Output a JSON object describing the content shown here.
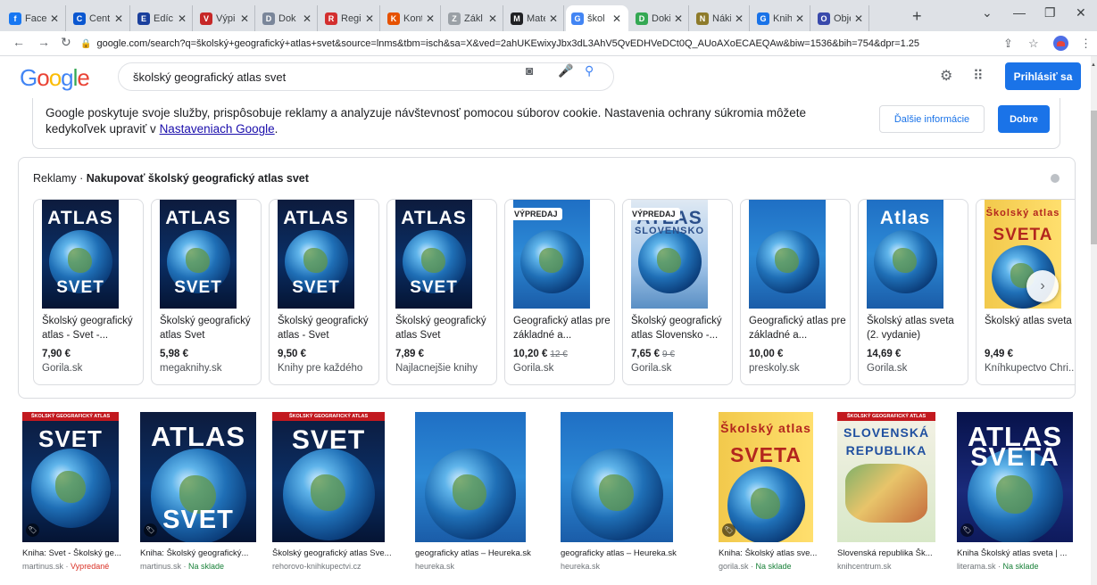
{
  "browser": {
    "tabs": [
      {
        "label": "Face",
        "color": "#1877f2",
        "glyph": "f"
      },
      {
        "label": "Cent",
        "color": "#0b57d0",
        "glyph": "C"
      },
      {
        "label": "Edíc",
        "color": "#1a3f9c",
        "glyph": "E"
      },
      {
        "label": "Výpi",
        "color": "#c62828",
        "glyph": "V"
      },
      {
        "label": "Dok",
        "color": "#7a869a",
        "glyph": "D"
      },
      {
        "label": "Regi",
        "color": "#d32f2f",
        "glyph": "R"
      },
      {
        "label": "Kont",
        "color": "#e65100",
        "glyph": "K"
      },
      {
        "label": "Zákl",
        "color": "#9aa0a6",
        "glyph": "Z"
      },
      {
        "label": "Mate",
        "color": "#202124",
        "glyph": "M"
      },
      {
        "label": "škol",
        "color": "#4285f4",
        "glyph": "G"
      },
      {
        "label": "Doki",
        "color": "#34a853",
        "glyph": "D"
      },
      {
        "label": "Náki",
        "color": "#8e7b2b",
        "glyph": "N"
      },
      {
        "label": "Knih",
        "color": "#1a73e8",
        "glyph": "G"
      },
      {
        "label": "Obje",
        "color": "#3949ab",
        "glyph": "O"
      }
    ],
    "url": "google.com/search?q=školský+geografický+atlas+svet&source=lnms&tbm=isch&sa=X&ved=2ahUKEwixyJbx3dL3AhV5QvEDHVeDCt0Q_AUoAXoECAEQAw&biw=1536&bih=754&dpr=1.25"
  },
  "header": {
    "logo": "Google",
    "query": "školský geografický atlas svet",
    "signin_label": "Prihlásiť sa"
  },
  "cookie": {
    "text_before": "Google poskytuje svoje služby, prispôsobuje reklamy a analyzuje návštevnosť pomocou súborov cookie. Nastavenia ochrany súkromia môžete kedykoľvek upraviť v ",
    "link": "Nastaveniach Google",
    "text_after": ".",
    "more_label": "Ďalšie informácie",
    "ok_label": "Dobre"
  },
  "ads": {
    "prefix": "Reklamy · ",
    "heading": "Nakupovať školský geografický atlas svet",
    "items": [
      {
        "title": "Školský geografický atlas - Svet -...",
        "price": "7,90 €",
        "old_price": "",
        "store": "Gorila.sk",
        "badge": "",
        "cover": {
          "style": "dark",
          "top": "ATLAS",
          "bottom": "SVET"
        }
      },
      {
        "title": "Školský geografický atlas Svet",
        "price": "5,98 €",
        "old_price": "",
        "store": "megaknihy.sk",
        "badge": "",
        "cover": {
          "style": "dark",
          "top": "ATLAS",
          "bottom": "SVET"
        }
      },
      {
        "title": "Školský geografický atlas - Svet",
        "price": "9,50 €",
        "old_price": "",
        "store": "Knihy pre každého",
        "badge": "",
        "cover": {
          "style": "dark",
          "top": "ATLAS",
          "bottom": "SVET"
        }
      },
      {
        "title": "Školský geografický atlas Svet",
        "price": "7,89 €",
        "old_price": "",
        "store": "Najlacnejšie knihy",
        "badge": "",
        "cover": {
          "style": "dark",
          "top": "ATLAS",
          "bottom": "SVET"
        }
      },
      {
        "title": "Geografický atlas pre základné a...",
        "price": "10,20 €",
        "old_price": "12 €",
        "store": "Gorila.sk",
        "badge": "VÝPREDAJ",
        "cover": {
          "style": "blue",
          "top": "",
          "bottom": ""
        }
      },
      {
        "title": "Školský geografický atlas Slovensko -...",
        "price": "7,65 €",
        "old_price": "9 €",
        "store": "Gorila.sk",
        "badge": "VÝPREDAJ",
        "cover": {
          "style": "white",
          "top": "ATLAS",
          "bottom": "SLOVENSKO"
        }
      },
      {
        "title": "Geografický atlas pre základné a...",
        "price": "10,00 €",
        "old_price": "",
        "store": "preskoly.sk",
        "badge": "",
        "cover": {
          "style": "blue",
          "top": "",
          "bottom": ""
        }
      },
      {
        "title": "Školský atlas sveta (2. vydanie)",
        "price": "14,69 €",
        "old_price": "",
        "store": "Gorila.sk",
        "badge": "",
        "cover": {
          "style": "blue",
          "top": "Atlas",
          "bottom": ""
        }
      },
      {
        "title": "Školský atlas sveta",
        "price": "9,49 €",
        "old_price": "",
        "store": "Kníhkupectvo Chri...",
        "badge": "",
        "cover": {
          "style": "yellow",
          "top": "Školský atlas",
          "bottom": "SVETA"
        }
      }
    ]
  },
  "images": [
    {
      "title": "Kniha: Svet - Školský ge...",
      "source": "martinus.sk",
      "stock": "Vypredané",
      "stock_kind": "no",
      "cover": {
        "style": "dark",
        "band": "ŠKOLSKÝ GEOGRAFICKÝ ATLAS",
        "top": "SVET",
        "bottom": ""
      }
    },
    {
      "title": "Kniha: Školský geografický...",
      "source": "martinus.sk",
      "stock": "Na sklade",
      "stock_kind": "ok",
      "cover": {
        "style": "dark",
        "band": "",
        "top": "ATLAS",
        "bottom": "SVET"
      }
    },
    {
      "title": "Školský geografický atlas Sve...",
      "source": "rehorovo-knihkupectvi.cz",
      "stock": "",
      "stock_kind": "",
      "cover": {
        "style": "dark",
        "band": "ŠKOLSKÝ GEOGRAFICKÝ ATLAS",
        "top": "SVET",
        "bottom": ""
      }
    },
    {
      "title": "geograficky atlas – Heureka.sk",
      "source": "heureka.sk",
      "stock": "",
      "stock_kind": "",
      "cover": {
        "style": "blue",
        "band": "",
        "top": "",
        "bottom": ""
      }
    },
    {
      "title": "geograficky atlas – Heureka.sk",
      "source": "heureka.sk",
      "stock": "",
      "stock_kind": "",
      "cover": {
        "style": "blue",
        "band": "",
        "top": "",
        "bottom": ""
      }
    },
    {
      "title": "Kniha: Školský atlas sve...",
      "source": "gorila.sk",
      "stock": "Na sklade",
      "stock_kind": "ok",
      "cover": {
        "style": "yellow",
        "band": "",
        "top": "Školský atlas",
        "bottom": "SVETA"
      }
    },
    {
      "title": "Slovenská republika Šk...",
      "source": "knihcentrum.sk",
      "stock": "",
      "stock_kind": "",
      "cover": {
        "style": "map",
        "band": "ŠKOLSKÝ GEOGRAFICKÝ ATLAS",
        "top": "SLOVENSKÁ",
        "bottom": "REPUBLIKA"
      }
    },
    {
      "title": "Kniha Školský atlas sveta | ...",
      "source": "literama.sk",
      "stock": "Na sklade",
      "stock_kind": "ok",
      "cover": {
        "style": "navy",
        "band": "",
        "top": "ATLAS",
        "bottom": "SVETA"
      }
    }
  ],
  "colors": {
    "accent": "#1a73e8",
    "link": "#1a0dab",
    "in_stock": "#188038",
    "sold_out": "#d93025"
  }
}
